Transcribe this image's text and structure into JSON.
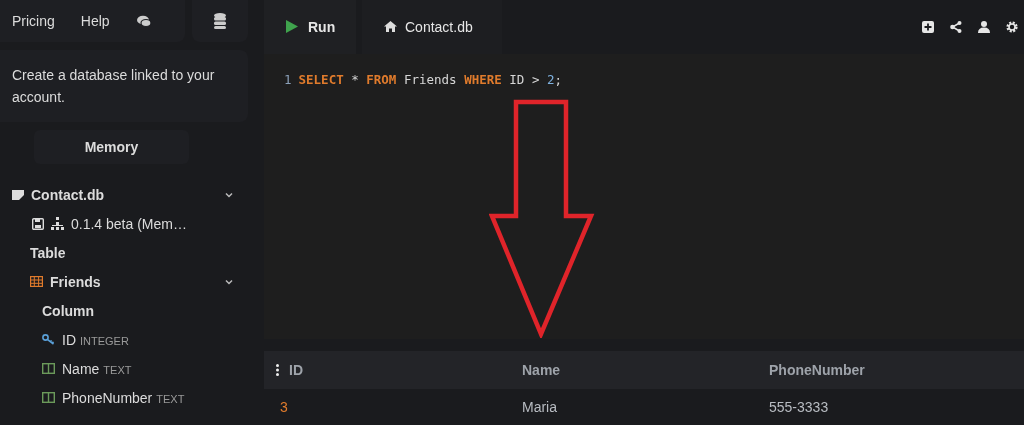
{
  "nav": {
    "links": [
      "Pricing",
      "Help"
    ]
  },
  "info": "Create a database linked to your account.",
  "memory_button": "Memory",
  "database": {
    "name": "Contact.db",
    "expanded": true,
    "version": "0.1.4 beta (Mem…",
    "table_heading": "Table",
    "tables": [
      {
        "name": "Friends",
        "expanded": true,
        "column_heading": "Column",
        "columns": [
          {
            "name": "ID",
            "type": "INTEGER",
            "kind": "key"
          },
          {
            "name": "Name",
            "type": "TEXT",
            "kind": "field"
          },
          {
            "name": "PhoneNumber",
            "type": "TEXT",
            "kind": "field"
          }
        ]
      }
    ]
  },
  "toolbar": {
    "run": "Run",
    "tab": "Contact.db"
  },
  "editor": {
    "lines": [
      {
        "number": "1",
        "tokens": [
          {
            "text": "SELECT",
            "kind": "keyword"
          },
          {
            "text": "*",
            "kind": "plain"
          },
          {
            "text": "FROM",
            "kind": "keyword"
          },
          {
            "text": "Friends",
            "kind": "plain"
          },
          {
            "text": "WHERE",
            "kind": "keyword"
          },
          {
            "text": "ID",
            "kind": "plain"
          },
          {
            "text": ">",
            "kind": "plain"
          },
          {
            "text": "2",
            "kind": "number"
          },
          {
            "text": ";",
            "kind": "punctuation"
          }
        ]
      }
    ]
  },
  "results": {
    "columns": [
      "ID",
      "Name",
      "PhoneNumber"
    ],
    "rows": [
      [
        "3",
        "Maria",
        "555-3333"
      ]
    ]
  }
}
